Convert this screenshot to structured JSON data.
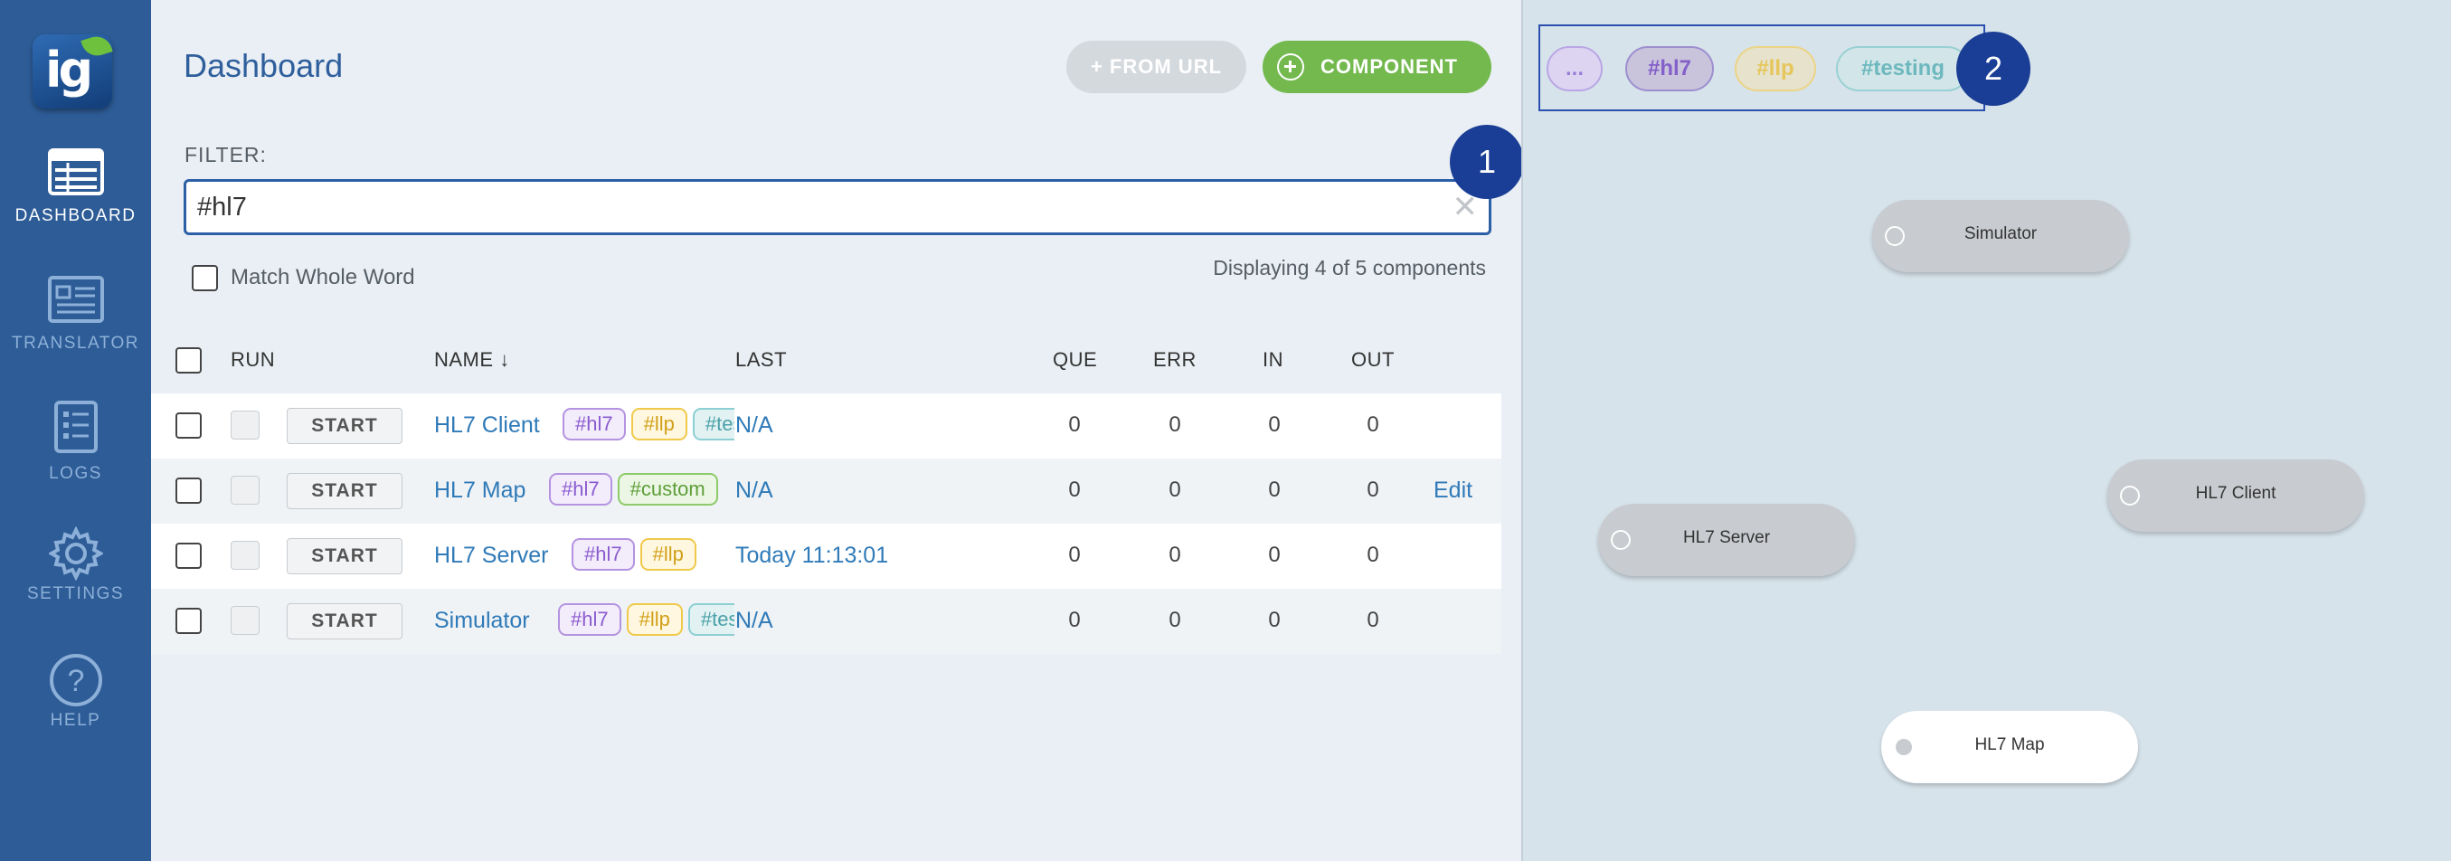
{
  "sidebar": {
    "logo_text": "ig",
    "items": [
      {
        "label": "DASHBOARD",
        "icon": "dashboard-icon",
        "active": true
      },
      {
        "label": "TRANSLATOR",
        "icon": "translator-icon",
        "active": false
      },
      {
        "label": "LOGS",
        "icon": "logs-icon",
        "active": false
      },
      {
        "label": "SETTINGS",
        "icon": "gear-icon",
        "active": false
      },
      {
        "label": "HELP",
        "icon": "help-icon",
        "active": false
      }
    ]
  },
  "header": {
    "title": "Dashboard",
    "from_url_label": "+ FROM URL",
    "component_label": "COMPONENT"
  },
  "filter": {
    "label": "FILTER:",
    "value": "#hl7",
    "match_whole_word_label": "Match Whole Word",
    "displaying": "Displaying 4 of 5 components"
  },
  "annotations": {
    "one": "1",
    "two": "2"
  },
  "table": {
    "columns": {
      "run": "RUN",
      "name": "NAME",
      "sort_arrow": "↓",
      "last": "LAST",
      "que": "QUE",
      "err": "ERR",
      "in": "IN",
      "out": "OUT"
    },
    "start_label": "START",
    "rows": [
      {
        "name": "HL7 Client",
        "tags": [
          "#hl7",
          "#llp",
          "#testing"
        ],
        "last": "N/A",
        "que": "0",
        "err": "0",
        "in": "0",
        "out": "0",
        "edit": ""
      },
      {
        "name": "HL7 Map",
        "tags": [
          "#hl7",
          "#custom"
        ],
        "last": "N/A",
        "que": "0",
        "err": "0",
        "in": "0",
        "out": "0",
        "edit": "Edit"
      },
      {
        "name": "HL7 Server",
        "tags": [
          "#hl7",
          "#llp"
        ],
        "last": "Today 11:13:01",
        "que": "0",
        "err": "0",
        "in": "0",
        "out": "0",
        "edit": ""
      },
      {
        "name": "Simulator",
        "tags": [
          "#hl7",
          "#llp",
          "#testing"
        ],
        "last": "N/A",
        "que": "0",
        "err": "0",
        "in": "0",
        "out": "0",
        "edit": ""
      }
    ]
  },
  "canvas": {
    "tag_pills": [
      "...",
      "#hl7",
      "#llp",
      "#testing"
    ],
    "nodes": [
      {
        "label": "Simulator",
        "state": "grey"
      },
      {
        "label": "HL7 Client",
        "state": "grey"
      },
      {
        "label": "HL7 Server",
        "state": "grey"
      },
      {
        "label": "HL7 Map",
        "state": "white"
      }
    ]
  },
  "colors": {
    "sidebar": "#2d5c97",
    "accent_green": "#73b94e",
    "annotation_blue": "#1a3e95",
    "link": "#2f7ab8"
  }
}
